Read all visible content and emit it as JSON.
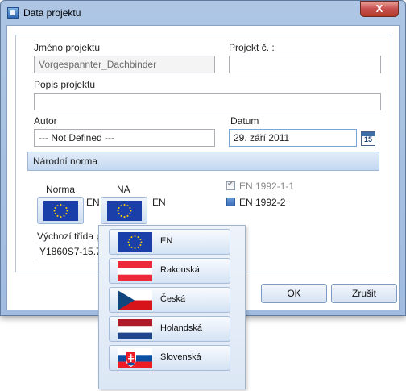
{
  "window": {
    "title": "Data projektu",
    "close_label": "X"
  },
  "fields": {
    "project_name_label": "Jméno projektu",
    "project_name_value": "Vorgespannter_Dachbinder",
    "project_no_label": "Projekt č. :",
    "project_no_value": "",
    "description_label": "Popis projektu",
    "description_value": "",
    "author_label": "Autor",
    "author_value": "--- Not Defined ---",
    "date_label": "Datum",
    "date_value": "29. září 2011",
    "calendar_day": "15"
  },
  "national_standard": {
    "header": "Národní norma",
    "norma_label": "Norma",
    "norma_code": "EN",
    "na_label": "NA",
    "na_code": "EN",
    "checks": [
      {
        "label": "EN 1992-1-1",
        "checked": true,
        "disabled": true
      },
      {
        "label": "EN 1992-2",
        "checked": false,
        "disabled": false
      }
    ],
    "default_class_label": "Výchozí třída p",
    "default_class_value": "Y1860S7-15.7"
  },
  "buttons": {
    "ok": "OK",
    "cancel": "Zrušit"
  },
  "popup": {
    "items": [
      {
        "label": "EN",
        "flag": "eu-flag-icon"
      },
      {
        "label": "Rakouská",
        "flag": "austria-flag-icon"
      },
      {
        "label": "Česká",
        "flag": "czech-flag-icon"
      },
      {
        "label": "Holandská",
        "flag": "netherlands-flag-icon"
      },
      {
        "label": "Slovenská",
        "flag": "slovakia-flag-icon"
      }
    ]
  },
  "colors": {
    "eu_blue": "#1a3fa8",
    "eu_star": "#ffd400",
    "title_gradient": "#aec6e4"
  }
}
